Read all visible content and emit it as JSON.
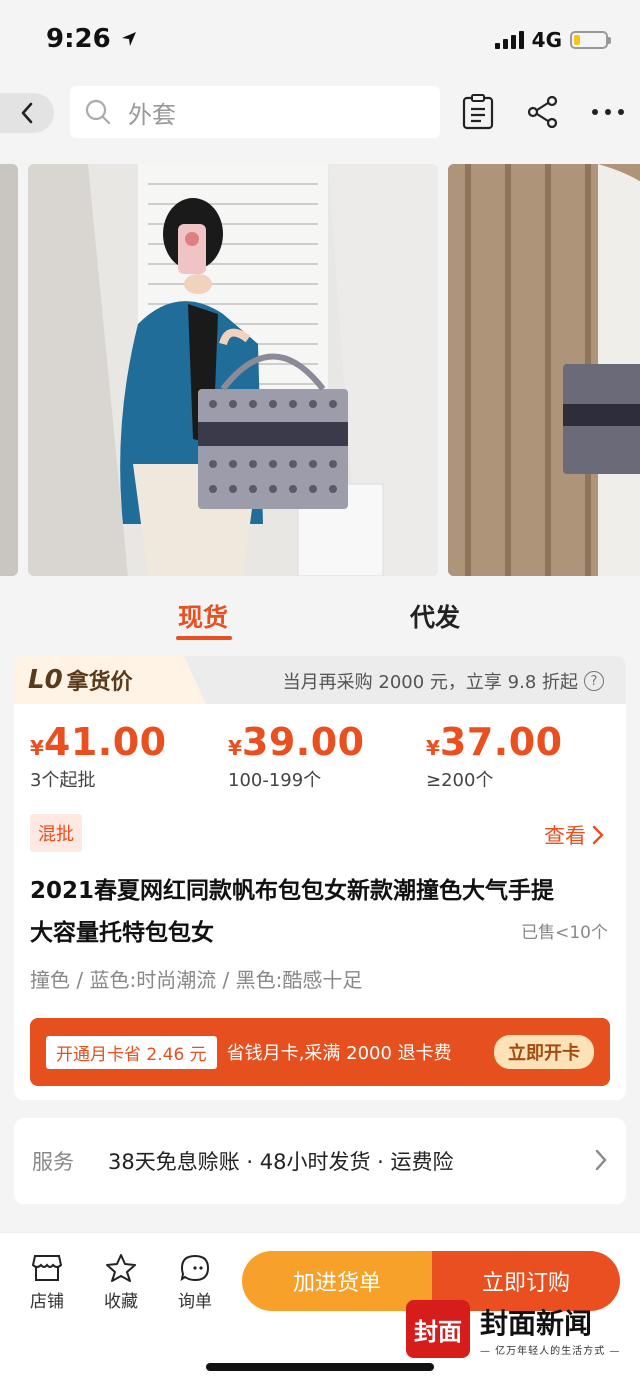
{
  "status_bar": {
    "time": "9:26",
    "network": "4G",
    "battery_level": 0.2
  },
  "nav": {
    "search_placeholder": "外套",
    "icons": [
      "back-icon",
      "search-icon",
      "clipboard-icon",
      "share-icon",
      "more-icon"
    ]
  },
  "tabs": [
    {
      "label": "现货",
      "active": true
    },
    {
      "label": "代发",
      "active": false
    }
  ],
  "price_header": {
    "logo": "L0",
    "label": "拿货价",
    "promo": "当月再采购 2000 元，立享 9.8 折起"
  },
  "price_tiers": [
    {
      "currency": "¥",
      "price": "41.00",
      "qty": "3个起批"
    },
    {
      "currency": "¥",
      "price": "39.00",
      "qty": "100-199个"
    },
    {
      "currency": "¥",
      "price": "37.00",
      "qty": "≥200个"
    }
  ],
  "mix_badge": "混批",
  "view_link": "查看",
  "product": {
    "title_line1": "2021春夏网红同款帆布包包女新款潮撞色大气手提",
    "title_line2": "大容量托特包包女",
    "sold": "已售<10个",
    "variants": "撞色 / 蓝色:时尚潮流 / 黑色:酷感十足"
  },
  "month_card": {
    "save": "开通月卡省 2.46 元",
    "text": "省钱月卡,采满 2000 退卡费",
    "button": "立即开卡"
  },
  "service": {
    "label": "服务",
    "text": "38天免息赊账 · 48小时发货 · 运费险"
  },
  "bottom_bar": {
    "shop": "店铺",
    "favorite": "收藏",
    "inquiry": "询单",
    "add_to_list": "加进货单",
    "order_now": "立即订购"
  },
  "watermark": {
    "seal": "封面",
    "title": "封面新闻",
    "subtitle": "— 亿万年轻人的生活方式 —"
  },
  "colors": {
    "accent": "#ea4f20",
    "orange": "#f7a12b",
    "seal_red": "#d71c1c"
  }
}
